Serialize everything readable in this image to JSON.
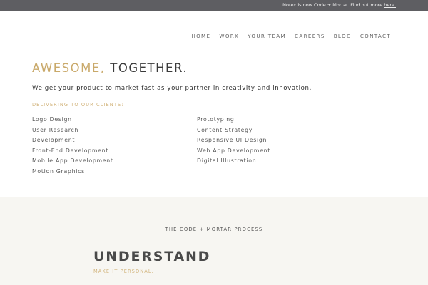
{
  "topbar": {
    "text": "Norex is now Code + Mortar. Find out more ",
    "link": "here."
  },
  "nav": [
    "HOME",
    "WORK",
    "YOUR TEAM",
    "CAREERS",
    "BLOG",
    "CONTACT"
  ],
  "hero": {
    "headline_accent": "AWESOME,",
    "headline_rest": "TOGETHER.",
    "intro": "We get your product to market fast as your partner in creativity and innovation."
  },
  "services": {
    "heading": "DELIVERING TO OUR CLIENTS:",
    "left": [
      "Logo Design",
      "User Research",
      "Development",
      "Front-End Development",
      "Mobile App Development",
      "Motion Graphics"
    ],
    "right": [
      "Prototyping",
      "Content Strategy",
      "Responsive UI Design",
      "Web App Development",
      "Digital Illustration"
    ]
  },
  "process": {
    "title": "THE CODE + MORTAR PROCESS",
    "step_title": "UNDERSTAND",
    "step_subtitle": "MAKE IT PERSONAL."
  },
  "colors": {
    "accent": "#c9a96a",
    "topbar_bg": "#5e5e62",
    "process_bg": "#f7f6f2"
  }
}
